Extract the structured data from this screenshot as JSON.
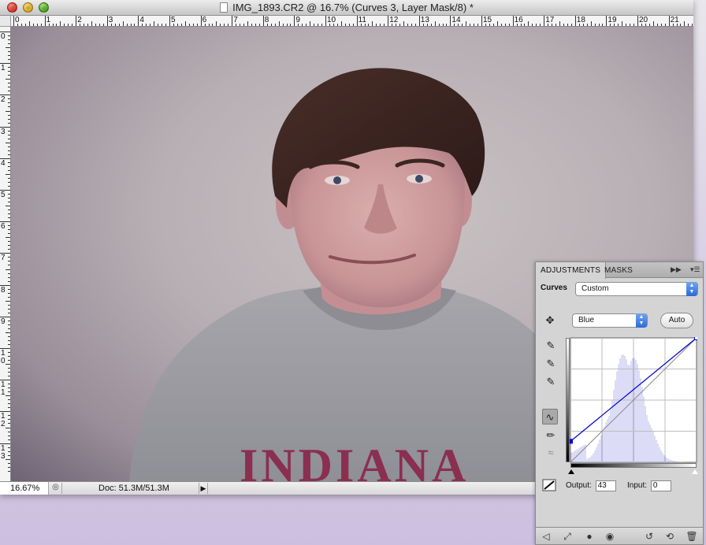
{
  "window": {
    "title": "IMG_1893.CR2 @ 16.7% (Curves 3, Layer Mask/8) *",
    "ruler_top": [
      "0",
      "1",
      "2",
      "3",
      "4",
      "5",
      "6",
      "7",
      "8",
      "9",
      "10",
      "11",
      "12",
      "13",
      "14",
      "15",
      "16",
      "17",
      "18",
      "19",
      "20",
      "21"
    ],
    "ruler_left": [
      "0",
      "1",
      "2",
      "3",
      "4",
      "5",
      "6",
      "7",
      "8",
      "9",
      "10",
      "11",
      "12",
      "13"
    ]
  },
  "photo": {
    "shirt_text": "INDIANA",
    "shirt_color": "#9d9da2",
    "hair_color": "#3a2420",
    "skin_color": "#cf9fa0",
    "print_color": "#8a2f50"
  },
  "status": {
    "zoom": "16.67%",
    "doc_size": "Doc: 51.3M/51.3M"
  },
  "panel": {
    "tab_adjustments": "ADJUSTMENTS",
    "tab_masks": "MASKS",
    "curves_label": "Curves",
    "preset_value": "Custom",
    "channel_value": "Blue",
    "auto_label": "Auto",
    "output_label": "Output:",
    "output_value": "43",
    "input_label": "Input:",
    "input_value": "0",
    "curve_color": "#0000cc",
    "histogram_color": "#b8b8ec",
    "curve_points": [
      [
        0,
        43
      ],
      [
        255,
        255
      ]
    ]
  }
}
